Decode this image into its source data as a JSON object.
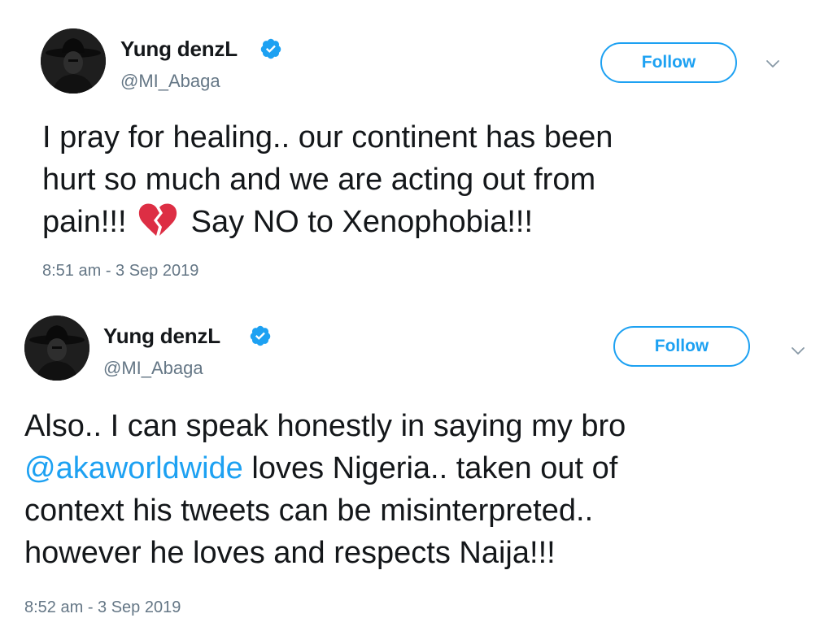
{
  "tweets": [
    {
      "user": {
        "display_name": "Yung denzL",
        "handle": "@MI_Abaga",
        "verified": true
      },
      "follow_label": "Follow",
      "text_lines": [
        "I pray for healing.. our continent has been",
        "hurt so much and we are acting out from"
      ],
      "line3_before": "pain!!!",
      "line3_after": "Say NO to Xenophobia!!!",
      "emoji": "broken-heart-icon",
      "timestamp": "8:51 am - 3 Sep 2019"
    },
    {
      "user": {
        "display_name": "Yung denzL",
        "handle": "@MI_Abaga",
        "verified": true
      },
      "follow_label": "Follow",
      "line1": "Also.. I can speak honestly in saying my bro",
      "mention": "@akaworldwide",
      "line2_after": " loves Nigeria.. taken out of",
      "line3": "context his tweets can be misinterpreted..",
      "line4": "however he loves and respects Naija!!!",
      "timestamp": "8:52 am - 3 Sep 2019"
    }
  ],
  "colors": {
    "accent": "#1da1f2",
    "text": "#14171a",
    "secondary": "#657786",
    "emoji_red": "#dd2e44"
  }
}
